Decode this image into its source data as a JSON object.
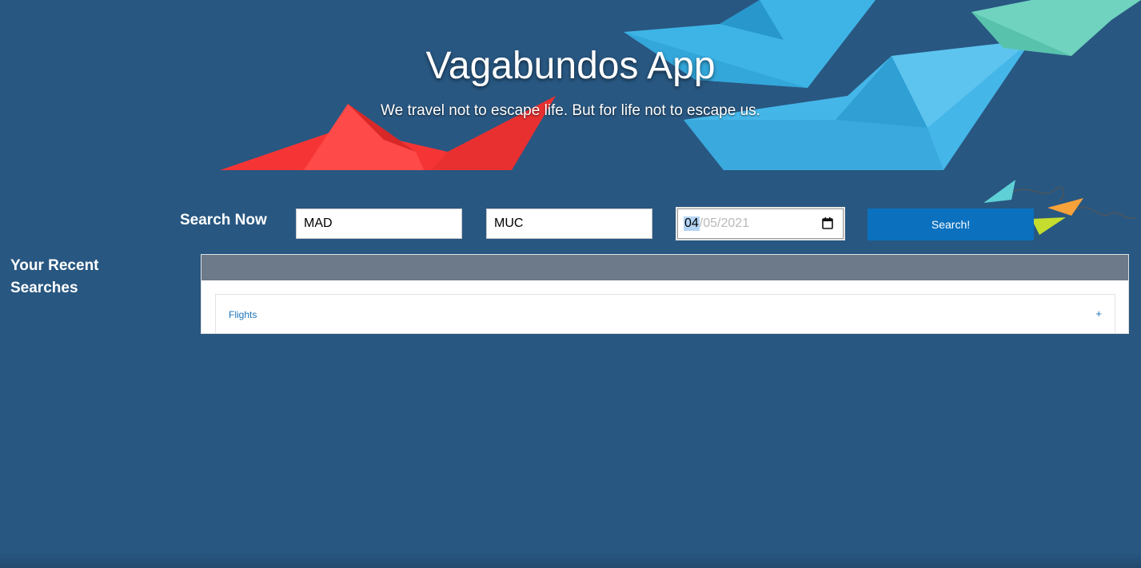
{
  "hero": {
    "title": "Vagabundos App",
    "subtitle": "We travel not to escape life. But for life not to escape us."
  },
  "search": {
    "label": "Search Now",
    "origin_value": "MAD",
    "destination_value": "MUC",
    "date": {
      "month": "04",
      "separator1": "/",
      "day": "05",
      "separator2": "/",
      "year": "2021"
    },
    "button_label": "Search!"
  },
  "recent": {
    "title": "Your Recent Searches",
    "items": [
      {
        "label": "Flights",
        "toggle": "+"
      }
    ]
  },
  "colors": {
    "background": "#285781",
    "button": "#0b71bf",
    "panel_header": "#6c7a8a",
    "link": "#1a73b8",
    "boat_red": "#ff3b3b",
    "boat_blue": "#3eb4e6",
    "boat_teal": "#5fcfb8"
  }
}
